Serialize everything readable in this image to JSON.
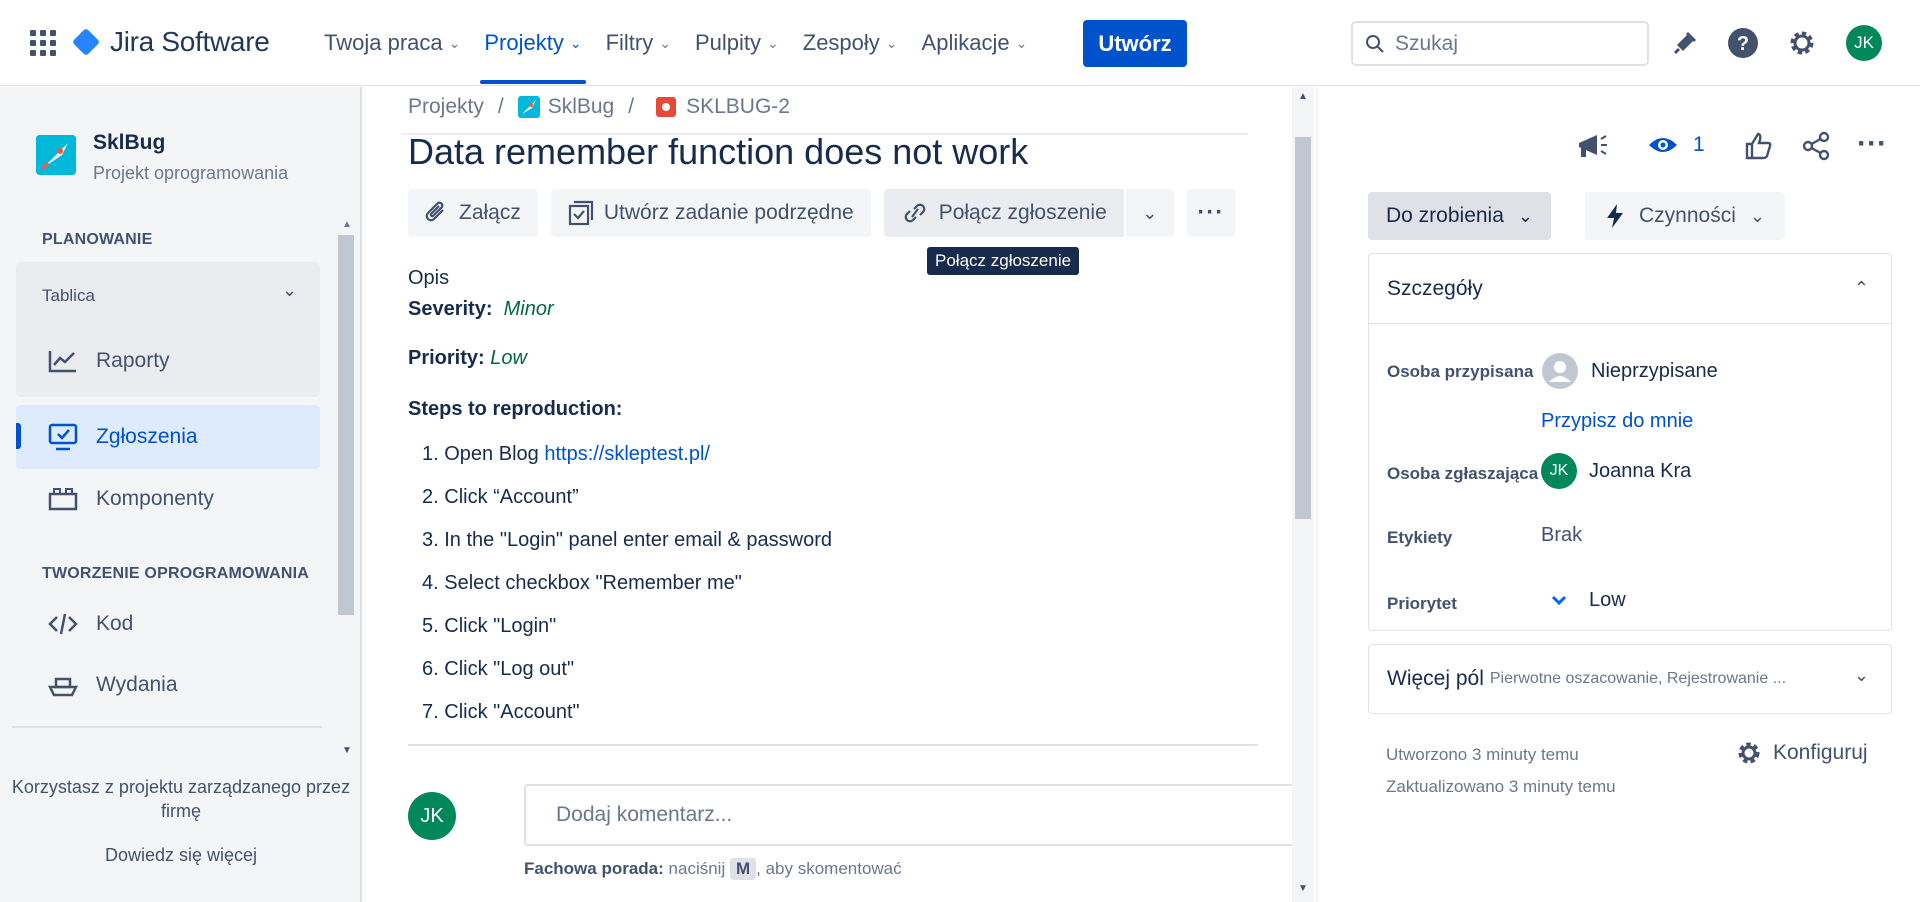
{
  "topbar": {
    "logo_text": "Jira Software",
    "nav": [
      {
        "label": "Twoja praca"
      },
      {
        "label": "Projekty"
      },
      {
        "label": "Filtry"
      },
      {
        "label": "Pulpity"
      },
      {
        "label": "Zespoły"
      },
      {
        "label": "Aplikacje"
      }
    ],
    "create_label": "Utwórz",
    "search_placeholder": "Szukaj",
    "avatar_initials": "JK"
  },
  "sidebar": {
    "project_name": "SklBug",
    "project_type": "Projekt oprogramowania",
    "planning_title": "PLANOWANIE",
    "board_label": "Tablica",
    "reports_label": "Raporty",
    "issues_label": "Zgłoszenia",
    "components_label": "Komponenty",
    "dev_title": "TWORZENIE OPROGRAMOWANIA",
    "code_label": "Kod",
    "releases_label": "Wydania",
    "managed_text": "Korzystasz z projektu zarządzanego przez firmę",
    "learn_more": "Dowiedz się więcej"
  },
  "breadcrumb": {
    "projects": "Projekty",
    "sep": "/",
    "project": "SklBug",
    "issue_key": "SKLBUG-2"
  },
  "issue": {
    "title": "Data remember function does not work",
    "attach_label": "Załącz",
    "subtask_label": "Utwórz zadanie podrzędne",
    "link_label": "Połącz zgłoszenie",
    "tooltip": "Połącz zgłoszenie",
    "description_label": "Opis",
    "severity_label": "Severity:",
    "severity_value": "Minor",
    "priority_label": "Priority:",
    "priority_value": "Low",
    "steps_title": "Steps to reproduction:",
    "steps": [
      {
        "num": "1.",
        "text": "Open Blog ",
        "link": "https://skleptest.pl/"
      },
      {
        "num": "2.",
        "text": "Click “Account”"
      },
      {
        "num": "3.",
        "text": "In the \"Login\" panel enter email & password"
      },
      {
        "num": "4.",
        "text": "Select checkbox \"Remember me\""
      },
      {
        "num": "5.",
        "text": "Click \"Login\""
      },
      {
        "num": "6.",
        "text": "Click \"Log out\""
      },
      {
        "num": "7.",
        "text": "Click \"Account\""
      }
    ]
  },
  "comment": {
    "avatar_initials": "JK",
    "placeholder": "Dodaj komentarz...",
    "tip_bold": "Fachowa porada:",
    "tip_pre": " naciśnij ",
    "tip_key": "M",
    "tip_post": ", aby skomentować"
  },
  "right": {
    "watchers": "1",
    "status_label": "Do zrobienia",
    "actions_label": "Czynności",
    "details_title": "Szczegóły",
    "assignee_label": "Osoba przypisana",
    "assignee_value": "Nieprzypisane",
    "assign_me": "Przypisz do mnie",
    "reporter_label": "Osoba zgłaszająca",
    "reporter_initials": "JK",
    "reporter_value": "Joanna Kra",
    "labels_label": "Etykiety",
    "labels_value": "Brak",
    "priority_label": "Priorytet",
    "priority_value": "Low",
    "more_fields": "Więcej pól",
    "more_fields_hint": "Pierwotne oszacowanie, Rejestrowanie ...",
    "created": "Utworzono 3 minuty temu",
    "updated": "Zaktualizowano 3 minuty temu",
    "configure": "Konfiguruj"
  },
  "colors": {
    "brand": "#0052cc",
    "avatar": "#00875a",
    "issue_type_bug": "#e5493a"
  }
}
